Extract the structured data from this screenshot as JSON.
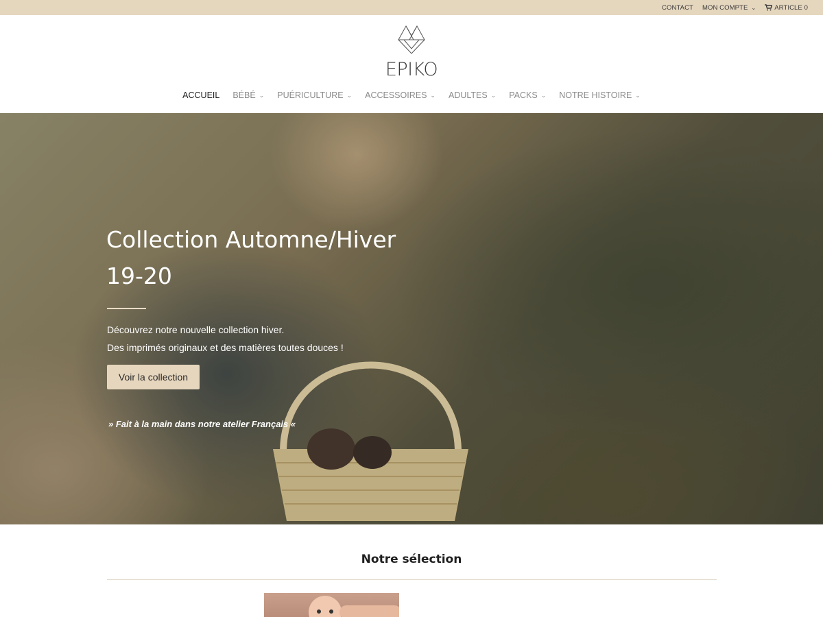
{
  "topbar": {
    "contact": "CONTACT",
    "account": "MON COMPTE",
    "cart": "ARTICLE 0"
  },
  "brand": {
    "name": "EPIKO"
  },
  "nav": {
    "items": [
      {
        "label": "ACCUEIL",
        "active": true,
        "dropdown": false
      },
      {
        "label": "BÉBÉ",
        "active": false,
        "dropdown": true
      },
      {
        "label": "PUÉRICULTURE",
        "active": false,
        "dropdown": true
      },
      {
        "label": "ACCESSOIRES",
        "active": false,
        "dropdown": true
      },
      {
        "label": "ADULTES",
        "active": false,
        "dropdown": true
      },
      {
        "label": "PACKS",
        "active": false,
        "dropdown": true
      },
      {
        "label": "NOTRE HISTOIRE",
        "active": false,
        "dropdown": true
      }
    ]
  },
  "hero": {
    "title_line1": "Collection Automne/Hiver",
    "title_line2": "19-20",
    "desc_line1": "Découvrez notre nouvelle collection hiver.",
    "desc_line2": "Des imprimés originaux et des matières toutes douces !",
    "button": "Voir la collection",
    "quote": "» Fait à la main dans notre atelier Français «"
  },
  "selection": {
    "title": "Notre sélection"
  },
  "colors": {
    "topbar_bg": "#e5d6be",
    "button_bg": "#e6d6bd",
    "accent": "#e9dcc7"
  },
  "icons": {
    "cart": "cart-icon",
    "chevron": "chevron-down-icon",
    "logo": "mountain-logo-icon"
  }
}
